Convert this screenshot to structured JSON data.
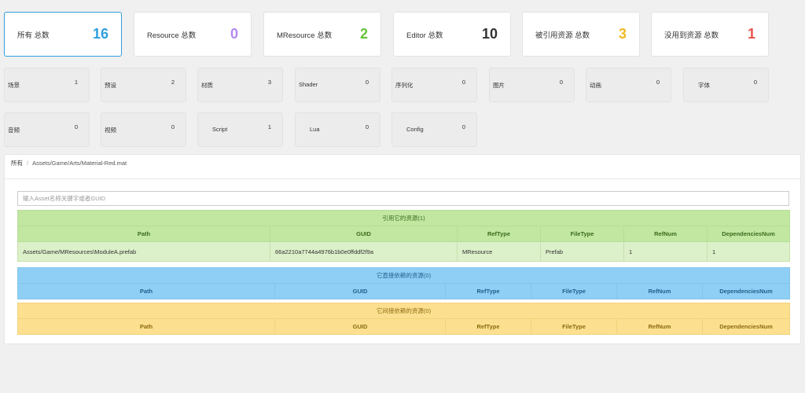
{
  "stats": [
    {
      "label": "所有 总数",
      "value": "16",
      "color": "#2f9fe0"
    },
    {
      "label": "Resource 总数",
      "value": "0",
      "color": "#b388f2"
    },
    {
      "label": "MResource 总数",
      "value": "2",
      "color": "#67c23a"
    },
    {
      "label": "Editor 总数",
      "value": "10",
      "color": "#333333"
    },
    {
      "label": "被引用资源 总数",
      "value": "3",
      "color": "#f0b922"
    },
    {
      "label": "没用到资源 总数",
      "value": "1",
      "color": "#e8534e"
    }
  ],
  "types": [
    {
      "label": "场景",
      "count": "1"
    },
    {
      "label": "预设",
      "count": "2"
    },
    {
      "label": "材质",
      "count": "3"
    },
    {
      "label": "Shader",
      "count": "0"
    },
    {
      "label": "序列化",
      "count": "0"
    },
    {
      "label": "图片",
      "count": "0"
    },
    {
      "label": "动画",
      "count": "0"
    },
    {
      "label": "字体",
      "count": "0"
    },
    {
      "label": "音频",
      "count": "0"
    },
    {
      "label": "视频",
      "count": "0"
    },
    {
      "label": "Script",
      "count": "1"
    },
    {
      "label": "Lua",
      "count": "0"
    },
    {
      "label": "Config",
      "count": "0"
    }
  ],
  "breadcrumb": {
    "root": "所有",
    "separator": "/",
    "path": "Assets/Game/Arts/Material-Red.mat"
  },
  "search": {
    "placeholder": "输入Asset名称关键字或者GUID",
    "value": ""
  },
  "columns": [
    "Path",
    "GUID",
    "RefType",
    "FileType",
    "RefNum",
    "DependenciesNum"
  ],
  "tables": {
    "referenced_by": {
      "title": "引用它的资源(1)",
      "rows": [
        [
          "Assets/Game/MResources\\ModuleA.prefab",
          "66a2210a7744a4976b1b0e0ffddf2f9a",
          "MResource",
          "Prefab",
          "1",
          "1"
        ]
      ]
    },
    "direct_deps": {
      "title": "它直接依赖的资源(0)",
      "rows": []
    },
    "indirect_deps": {
      "title": "它间接依赖的资源(0)",
      "rows": []
    }
  }
}
